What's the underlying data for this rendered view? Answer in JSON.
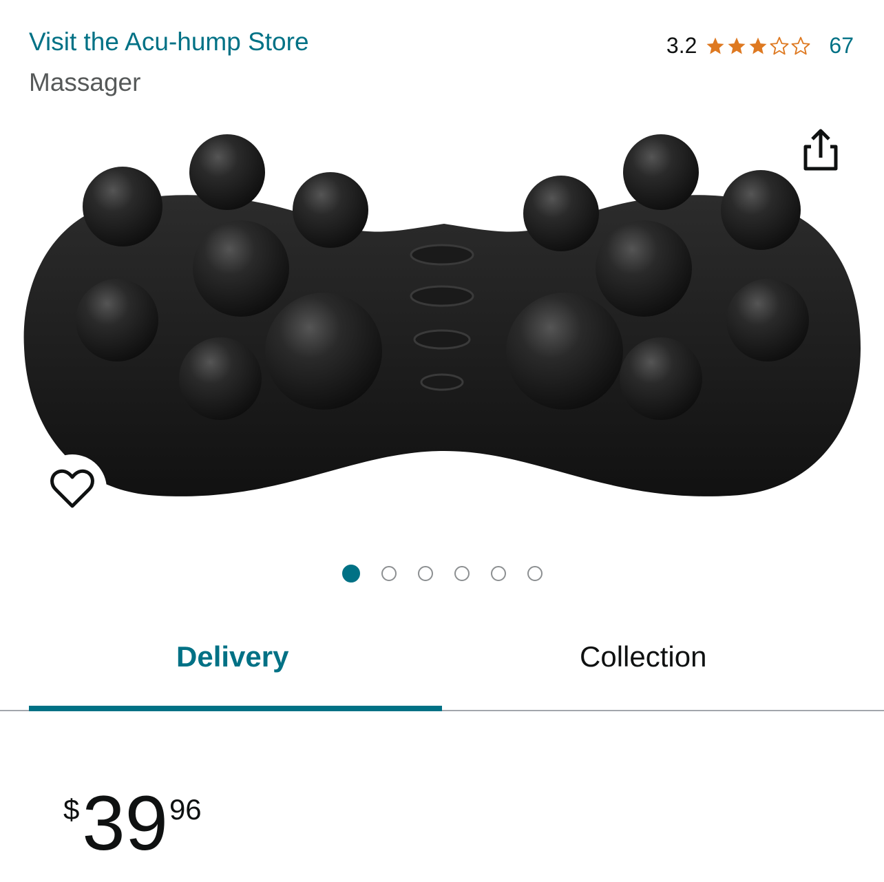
{
  "header": {
    "store_link": "Visit the Acu-hump Store",
    "subtitle": "Massager",
    "rating_value": "3.2",
    "rating_stars": 3.2,
    "rating_count": "67"
  },
  "gallery": {
    "image_count": 6,
    "active_index": 0
  },
  "tabs": [
    {
      "label": "Delivery",
      "active": true
    },
    {
      "label": "Collection",
      "active": false
    }
  ],
  "price": {
    "symbol": "$",
    "whole": "39",
    "fraction": "96"
  },
  "colors": {
    "accent": "#007185",
    "star": "#de7921"
  },
  "icons": {
    "share": "share-icon",
    "wishlist": "heart-icon"
  }
}
